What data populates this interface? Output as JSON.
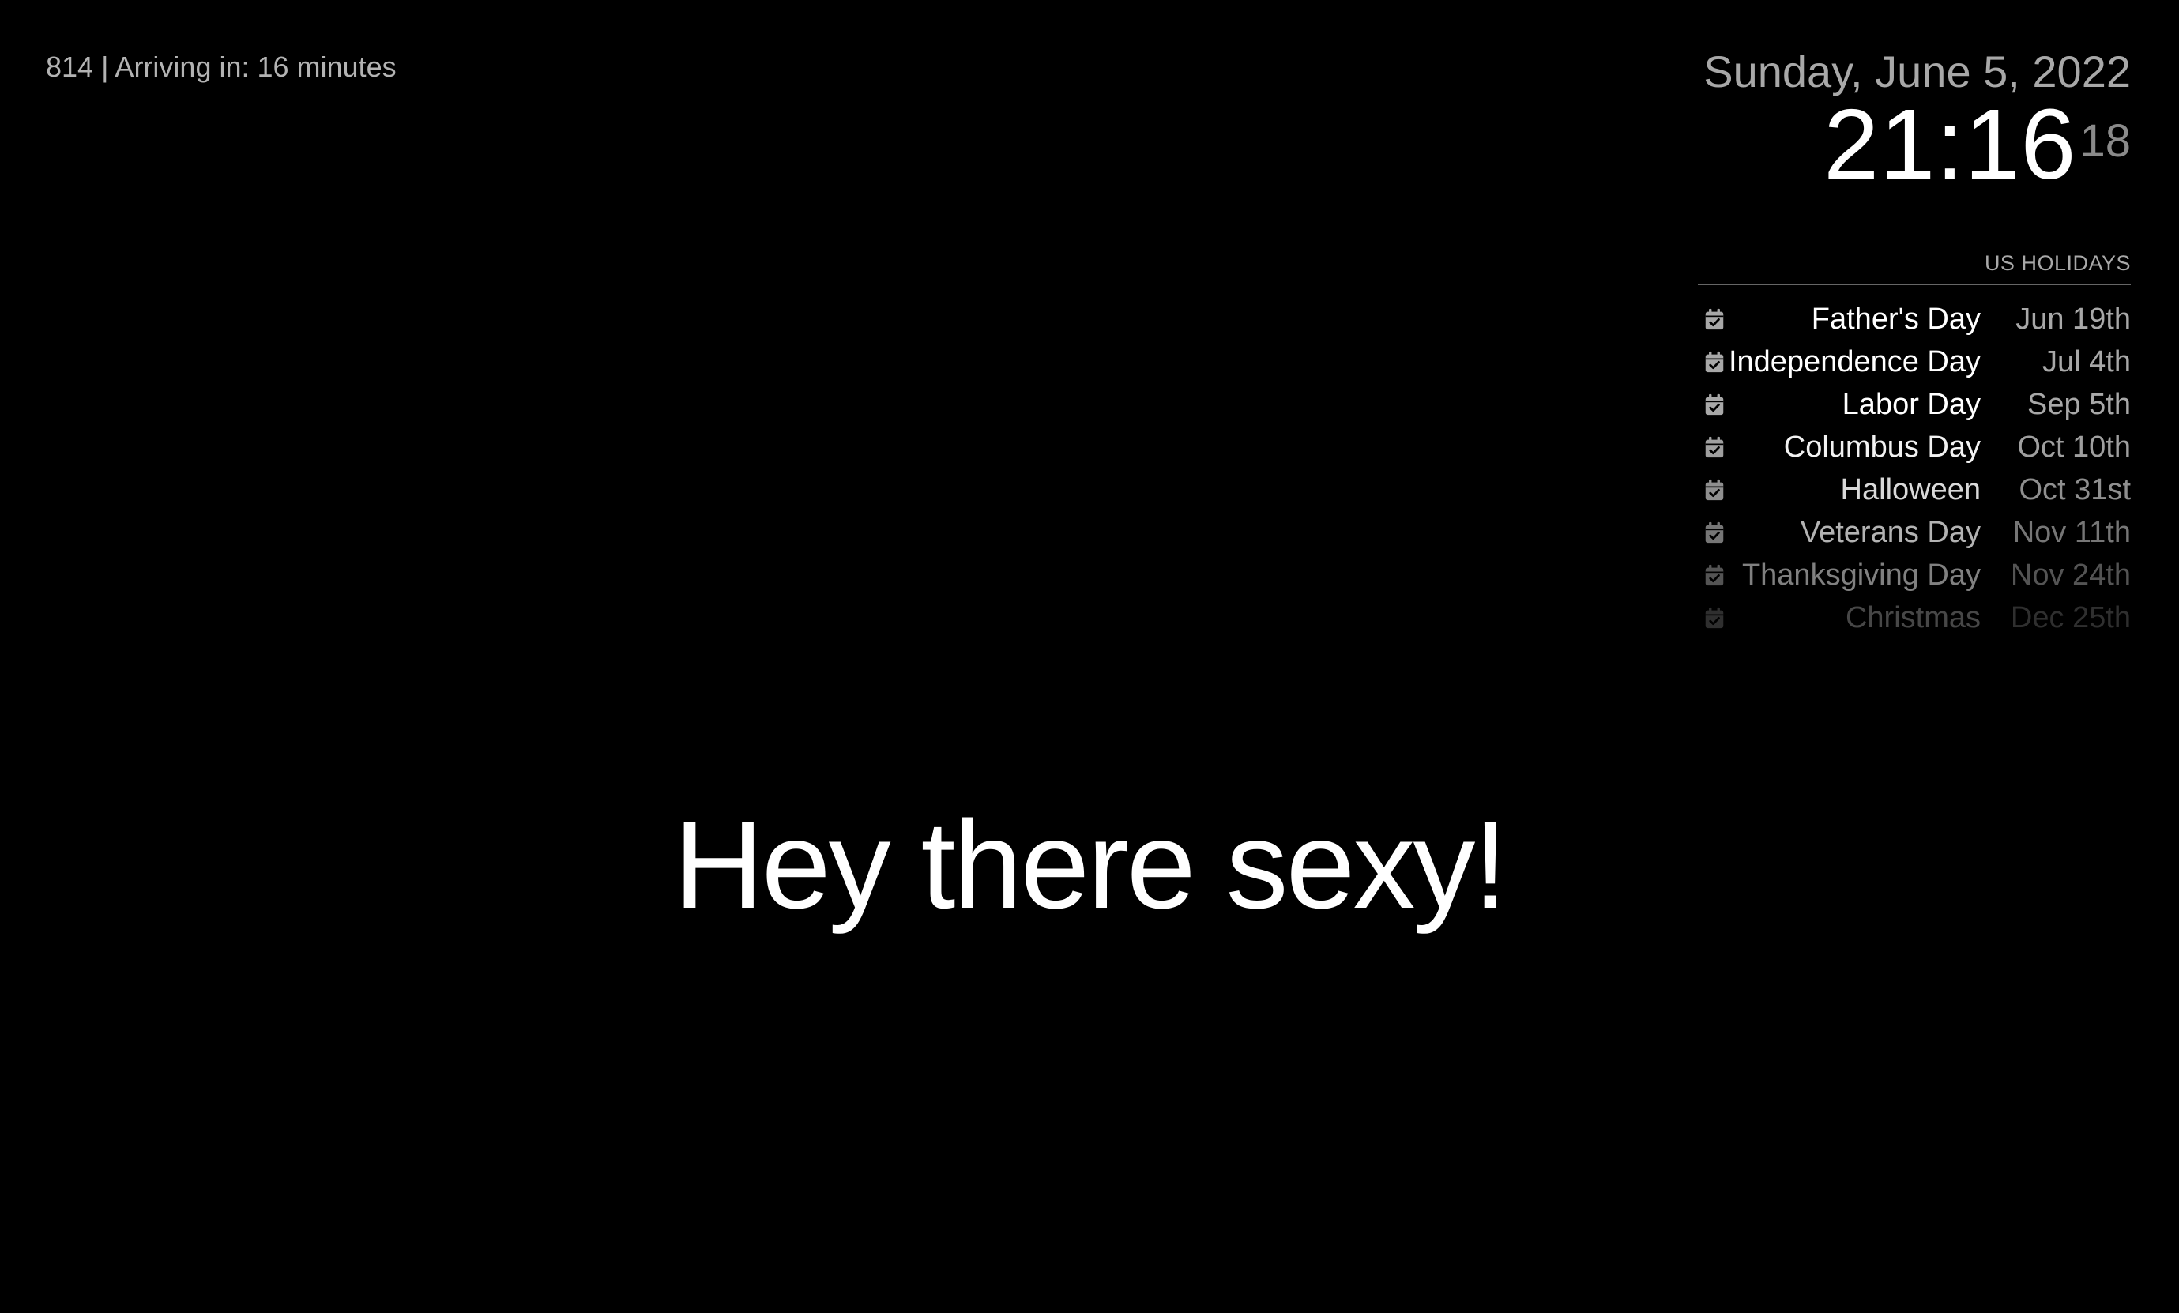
{
  "transit": {
    "text": "814 | Arriving in: 16 minutes"
  },
  "clock": {
    "date": "Sunday, June 5, 2022",
    "time": "21:16",
    "seconds": "18"
  },
  "calendar": {
    "header": "US HOLIDAYS",
    "icon": "calendar-check-icon",
    "events": [
      {
        "title": "Father's Day",
        "date": "Jun 19th",
        "opacity": 1.0
      },
      {
        "title": "Independence Day",
        "date": "Jul 4th",
        "opacity": 1.0
      },
      {
        "title": "Labor Day",
        "date": "Sep 5th",
        "opacity": 1.0
      },
      {
        "title": "Columbus Day",
        "date": "Oct 10th",
        "opacity": 0.95
      },
      {
        "title": "Halloween",
        "date": "Oct 31st",
        "opacity": 0.85
      },
      {
        "title": "Veterans Day",
        "date": "Nov 11th",
        "opacity": 0.7
      },
      {
        "title": "Thanksgiving Day",
        "date": "Nov 24th",
        "opacity": 0.5
      },
      {
        "title": "Christmas",
        "date": "Dec 25th",
        "opacity": 0.28
      }
    ]
  },
  "compliment": {
    "text": "Hey there sexy!"
  },
  "colors": {
    "background": "#000000",
    "primary_text": "#ffffff",
    "dimmed_text": "#a8a8a8",
    "divider": "#666666"
  }
}
